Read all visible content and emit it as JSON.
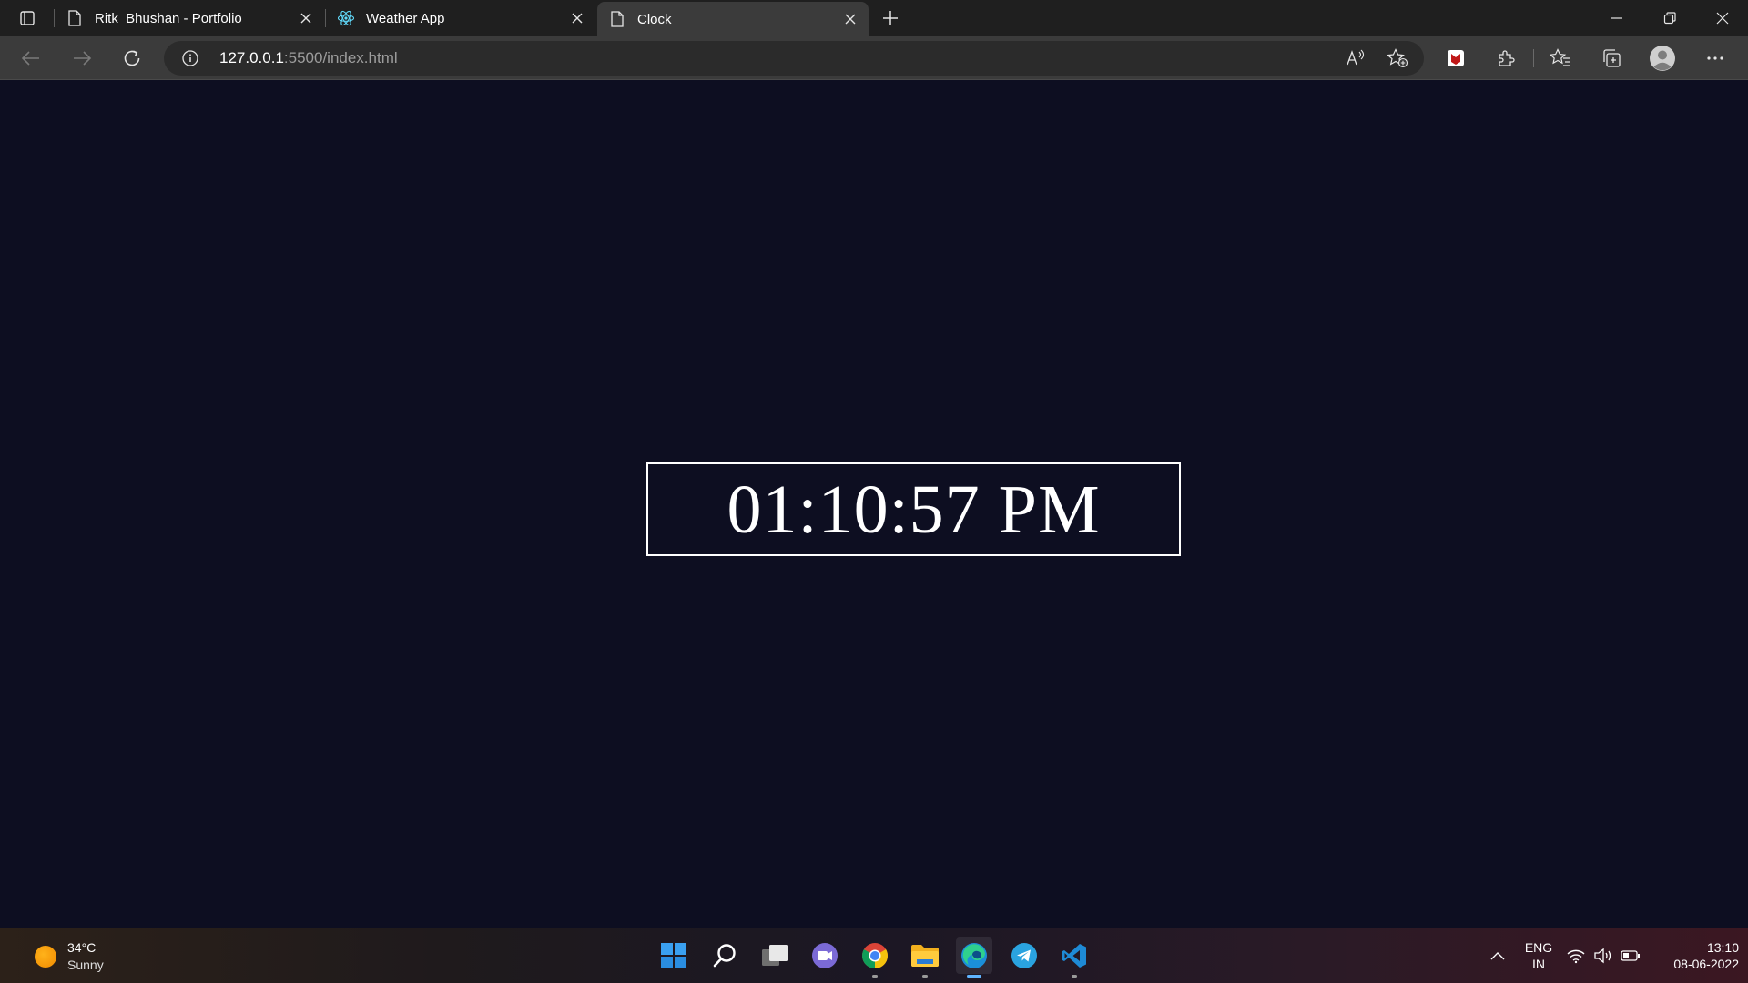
{
  "browser": {
    "tabs": [
      {
        "title": "Ritk_Bhushan - Portfolio",
        "icon": "page-icon",
        "active": false
      },
      {
        "title": "Weather App",
        "icon": "react-icon",
        "active": false
      },
      {
        "title": "Clock",
        "icon": "page-icon",
        "active": true
      }
    ],
    "address": {
      "host": "127.0.0.1",
      "path": ":5500/index.html"
    }
  },
  "page": {
    "clock_time": "01:10:57 PM"
  },
  "taskbar": {
    "weather": {
      "temp": "34°C",
      "condition": "Sunny"
    },
    "language": {
      "line1": "ENG",
      "line2": "IN"
    },
    "clock": {
      "time": "13:10",
      "date": "08-06-2022"
    },
    "apps": [
      "start-icon",
      "search-icon",
      "task-view-icon",
      "teams-chat-icon",
      "chrome-icon",
      "file-explorer-icon",
      "edge-icon",
      "telegram-icon",
      "vscode-icon"
    ]
  },
  "colors": {
    "page_background": "#0d0e21",
    "clock_border": "#ffffff",
    "clock_text": "#ffffff"
  }
}
